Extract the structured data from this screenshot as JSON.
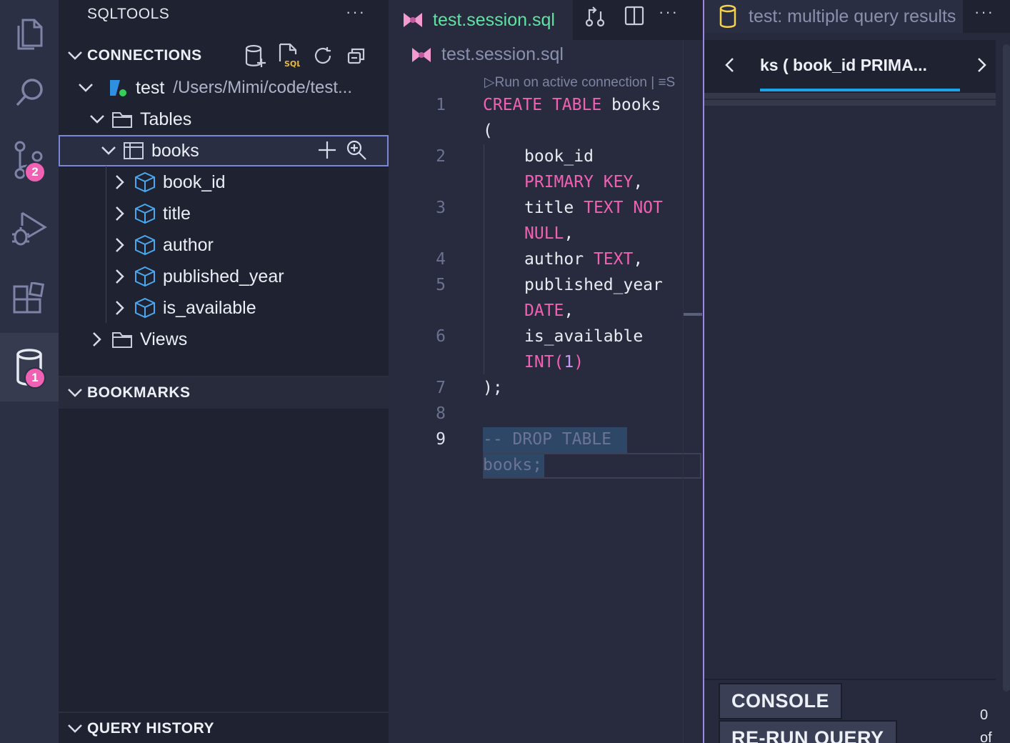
{
  "activity_bar": {
    "items": [
      {
        "name": "explorer",
        "icon": "files-icon"
      },
      {
        "name": "search",
        "icon": "search-icon"
      },
      {
        "name": "source-control",
        "icon": "source-control-icon",
        "badge": "2"
      },
      {
        "name": "run-debug",
        "icon": "run-debug-icon"
      },
      {
        "name": "extensions",
        "icon": "extensions-icon"
      },
      {
        "name": "sqltools",
        "icon": "database-icon",
        "badge": "1",
        "active": true
      }
    ]
  },
  "sidebar": {
    "title": "SQLTOOLS",
    "more": "···",
    "connections": {
      "header": "CONNECTIONS",
      "connection": {
        "name": "test",
        "path": "/Users/Mimi/code/test..."
      },
      "tables_label": "Tables",
      "table": {
        "name": "books"
      },
      "columns": [
        "book_id",
        "title",
        "author",
        "published_year",
        "is_available"
      ],
      "views_label": "Views"
    },
    "bookmarks": {
      "header": "BOOKMARKS"
    },
    "query_history": {
      "header": "QUERY HISTORY"
    }
  },
  "editor": {
    "tab": {
      "label": "test.session.sql"
    },
    "more": "···",
    "breadcrumb": "test.session.sql",
    "codelens": "▷Run on active connection | ≡S",
    "line_numbers": [
      "1",
      "2",
      "3",
      "4",
      "5",
      "6",
      "7",
      "8",
      "9"
    ],
    "code": {
      "l1_kw1": "CREATE",
      "l1_kw2": "TABLE",
      "l1_id": " books",
      "l1b": "(",
      "l2a": "book_id",
      "l2b_kw": "PRIMARY KEY",
      "l2b_p": ",",
      "l3a_id": "title ",
      "l3a_kw": "TEXT NOT",
      "l3b_kw": "NULL",
      "l3b_p": ",",
      "l4_id": "author ",
      "l4_kw": "TEXT",
      "l4_p": ",",
      "l5a": "published_year",
      "l5b_kw": "DATE",
      "l5b_p": ",",
      "l6a": "is_available",
      "l6b_kw": "INT(",
      "l6b_num": "1",
      "l6b_kw2": ")",
      "l7": ");",
      "l9a": "-- DROP TABLE",
      "l9b": "books;"
    }
  },
  "results": {
    "tab_label": "test: multiple query results",
    "more": "···",
    "query_tab_label": "ks ( book_id PRIMA...",
    "console_button": "CONSOLE",
    "rerun_button": "RE-RUN QUERY",
    "count_top": "0",
    "count_bottom": "of"
  },
  "colors": {
    "accent_pink": "#f161b3",
    "tab_green": "#5fe3a1",
    "selection_outline": "#7a87d6",
    "underline_blue": "#1da3e8"
  }
}
